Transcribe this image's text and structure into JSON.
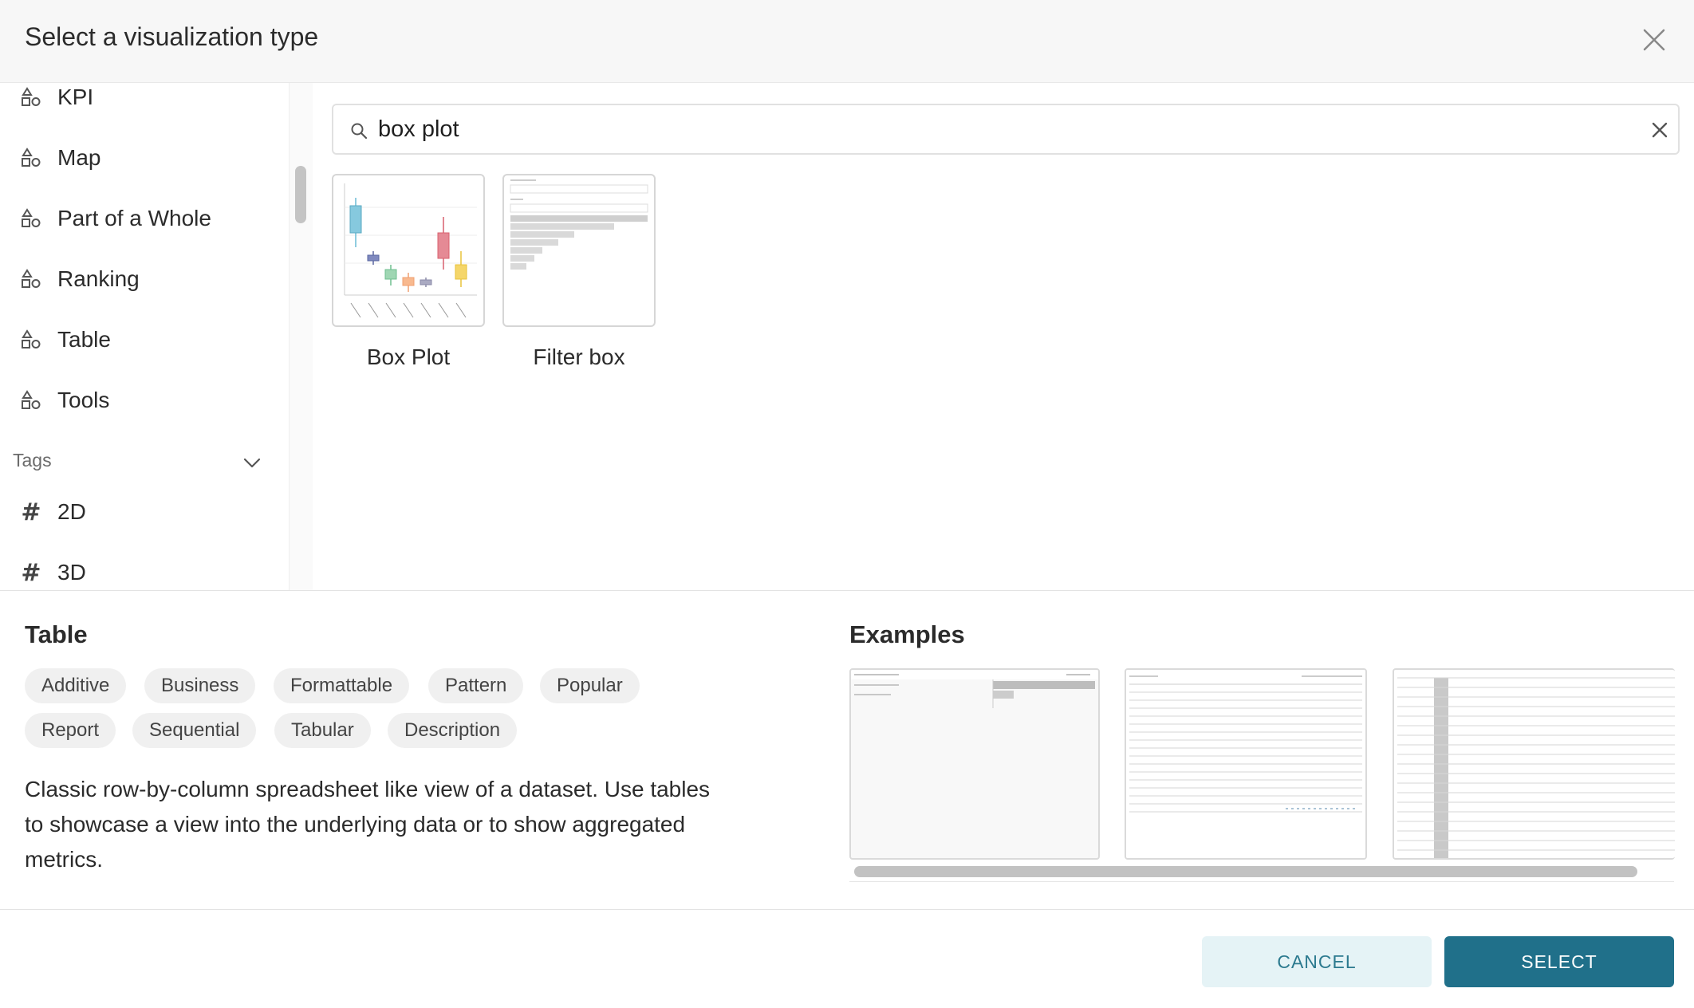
{
  "modal": {
    "title": "Select a visualization type"
  },
  "sidebar": {
    "categories": [
      {
        "label": "KPI",
        "icon": "shapes-icon"
      },
      {
        "label": "Map",
        "icon": "shapes-icon"
      },
      {
        "label": "Part of a Whole",
        "icon": "shapes-icon"
      },
      {
        "label": "Ranking",
        "icon": "shapes-icon"
      },
      {
        "label": "Table",
        "icon": "shapes-icon"
      },
      {
        "label": "Tools",
        "icon": "shapes-icon"
      }
    ],
    "tags_label": "Tags",
    "tags": [
      {
        "label": "2D",
        "icon": "hash-icon"
      },
      {
        "label": "3D",
        "icon": "hash-icon"
      }
    ]
  },
  "search": {
    "value": "box plot"
  },
  "results": [
    {
      "label": "Box Plot"
    },
    {
      "label": "Filter box"
    }
  ],
  "details": {
    "title": "Table",
    "tags": [
      "Additive",
      "Business",
      "Formattable",
      "Pattern",
      "Popular",
      "Report",
      "Sequential",
      "Tabular",
      "Description"
    ],
    "description": "Classic row-by-column spreadsheet like view of a dataset. Use tables to showcase a view into the underlying data or to show aggregated metrics.",
    "examples_title": "Examples"
  },
  "footer": {
    "cancel_label": "CANCEL",
    "select_label": "SELECT"
  },
  "colors": {
    "primary": "#20708a",
    "primary_light": "#e5f3f6",
    "header_bg": "#f7f7f7"
  }
}
